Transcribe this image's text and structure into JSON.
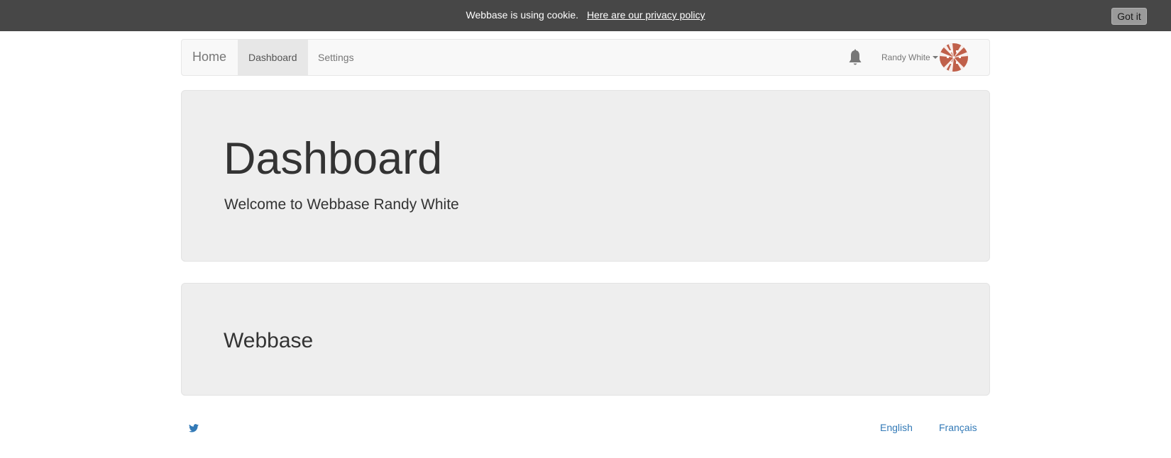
{
  "cookie_bar": {
    "message": "Webbase is using cookie.",
    "link_text": "Here are our privacy policy",
    "button_label": "Got it",
    "background": "#474747"
  },
  "navbar": {
    "brand": "Home",
    "items": [
      {
        "label": "Dashboard",
        "active": true
      },
      {
        "label": "Settings",
        "active": false
      }
    ],
    "notification_icon": "bell-icon",
    "user_name": "Randy White",
    "avatar_color": "#c0604a"
  },
  "jumbotron": {
    "title": "Dashboard",
    "subtitle": "Welcome to Webbase Randy White"
  },
  "panel": {
    "title": "Webbase"
  },
  "footer": {
    "social_icon": "twitter-icon",
    "languages": [
      "English",
      "Français"
    ],
    "link_color": "#337ab7"
  }
}
